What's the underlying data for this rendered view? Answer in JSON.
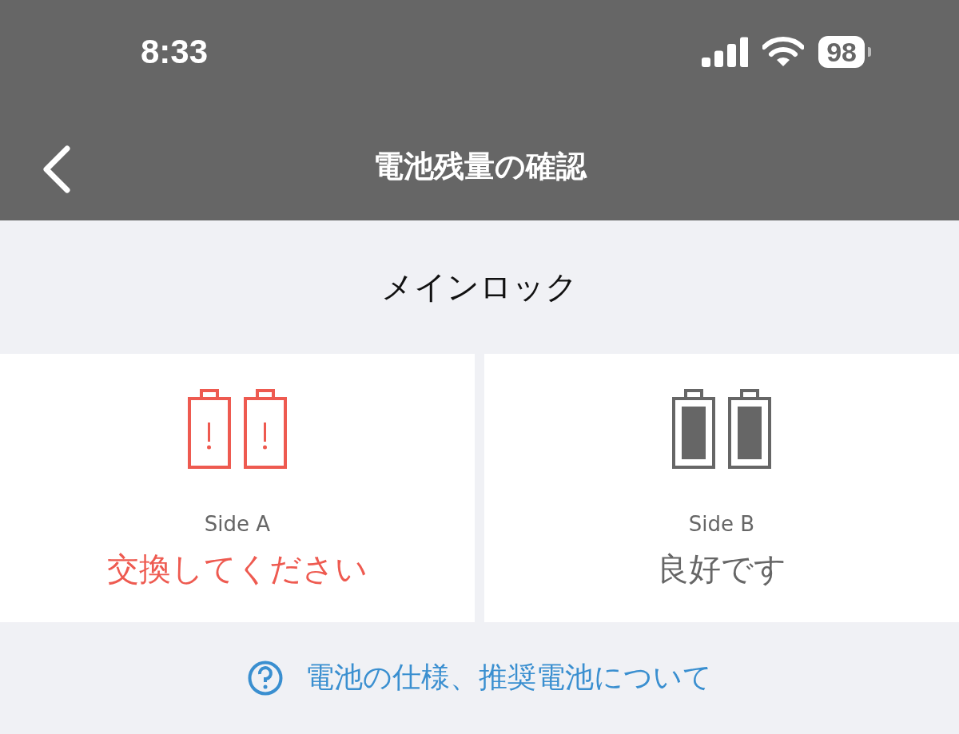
{
  "status_bar": {
    "time": "8:33",
    "battery": "98"
  },
  "nav": {
    "title": "電池残量の確認"
  },
  "section": {
    "title": "メインロック"
  },
  "sides": [
    {
      "label": "Side A",
      "status": "交換してください",
      "kind": "low"
    },
    {
      "label": "Side B",
      "status": "良好です",
      "kind": "good"
    }
  ],
  "help_link": "電池の仕様、推奨電池について"
}
